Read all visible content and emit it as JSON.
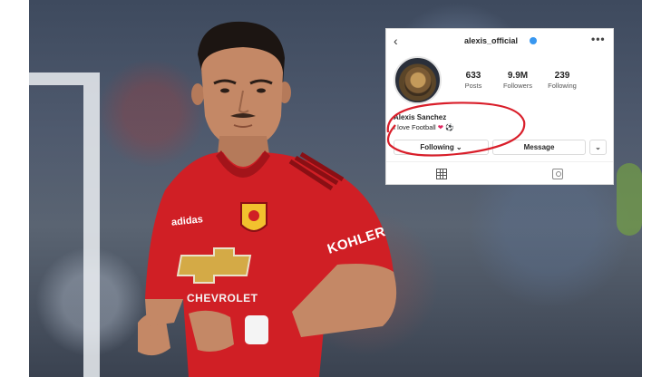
{
  "photo": {
    "kit": {
      "sleeve_sponsor": "KOHLER",
      "chest_sponsor": "CHEVROLET",
      "brand": "adidas"
    }
  },
  "instagram": {
    "username": "alexis_official",
    "stats": [
      {
        "value": "633",
        "label": "Posts"
      },
      {
        "value": "9.9M",
        "label": "Followers"
      },
      {
        "value": "239",
        "label": "Following"
      }
    ],
    "name": "Alexis Sanchez",
    "bio": "I love Football",
    "bio_emoji_heart": "❤",
    "bio_emoji_ball": "⚽",
    "following_button": "Following ⌄",
    "message_button": "Message",
    "dropdown_caret": "⌄",
    "back_glyph": "‹",
    "more_glyph": "•••"
  },
  "annotation": {
    "circle_color": "#d91e2a"
  },
  "colors": {
    "kit_red": "#d01f25",
    "verified_blue": "#3897f0"
  },
  "icons": [
    "back-icon",
    "verified-icon",
    "more-icon",
    "grid-icon",
    "tagged-icon"
  ]
}
